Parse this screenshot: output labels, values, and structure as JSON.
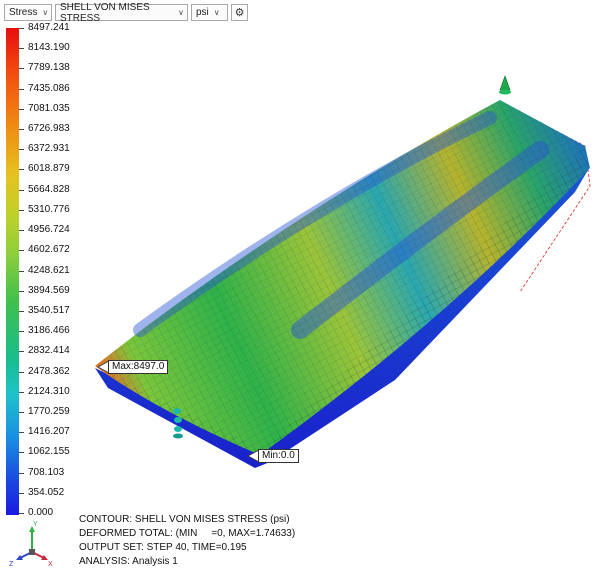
{
  "toolbar": {
    "category": "Stress",
    "result_type": "SHELL VON MISES STRESS",
    "unit": "psi",
    "settings_icon": "gear-icon"
  },
  "legend": {
    "values": [
      "8497.241",
      "8143.190",
      "7789.138",
      "7435.086",
      "7081.035",
      "6726.983",
      "6372.931",
      "6018.879",
      "5664.828",
      "5310.776",
      "4956.724",
      "4602.672",
      "4248.621",
      "3894.569",
      "3540.517",
      "3186.466",
      "2832.414",
      "2478.362",
      "2124.310",
      "1770.259",
      "1416.207",
      "1062.155",
      "708.103",
      "354.052",
      "0.000"
    ]
  },
  "callouts": {
    "max": "Max:8497.0",
    "min": "Min:0.0"
  },
  "info": {
    "contour": "CONTOUR: SHELL VON MISES STRESS (psi)",
    "deformed": "DEFORMED TOTAL: (MIN     =0, MAX=1.74633)",
    "output_set": "OUTPUT SET: STEP 40, TIME=0.195",
    "analysis": "ANALYSIS: Analysis 1"
  },
  "triad": {
    "x": "X",
    "y": "Y",
    "z": "Z"
  },
  "colors": {
    "max_red": "#e60e0e",
    "min_blue": "#1a1ae0",
    "mesh_green": "#2fb24a"
  }
}
